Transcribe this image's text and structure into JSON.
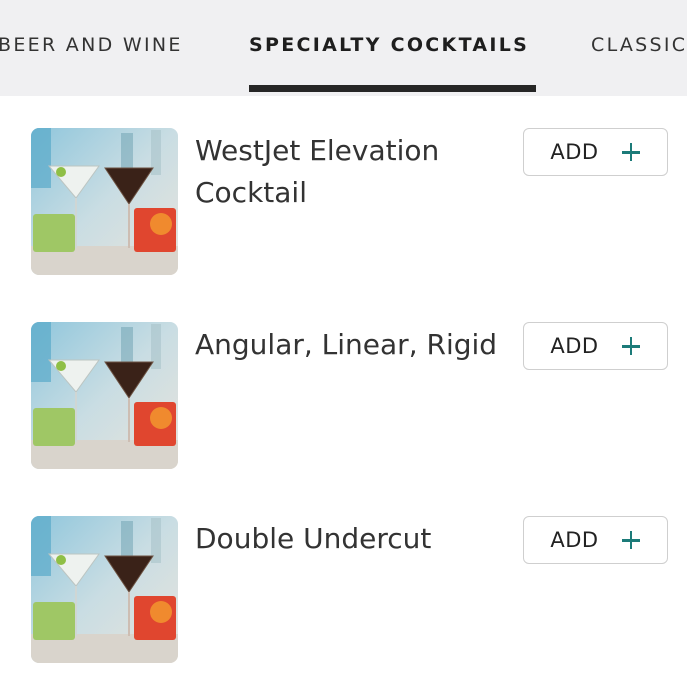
{
  "tabs": [
    {
      "label": "BEER AND WINE"
    },
    {
      "label": "SPECIALTY COCKTAILS",
      "active": true
    },
    {
      "label": "CLASSIC"
    }
  ],
  "items": [
    {
      "name": "WestJet Elevation Cocktail",
      "add_label": "ADD",
      "icon": "plus-icon"
    },
    {
      "name": "Angular, Linear, Rigid",
      "add_label": "ADD",
      "icon": "plus-icon"
    },
    {
      "name": "Double Undercut",
      "add_label": "ADD",
      "icon": "plus-icon"
    }
  ],
  "colors": {
    "tab_bar_bg": "#f0f0f2",
    "active_indicator": "#262626",
    "plus_accent": "#1c7b79",
    "button_border": "#cfcfcf"
  }
}
